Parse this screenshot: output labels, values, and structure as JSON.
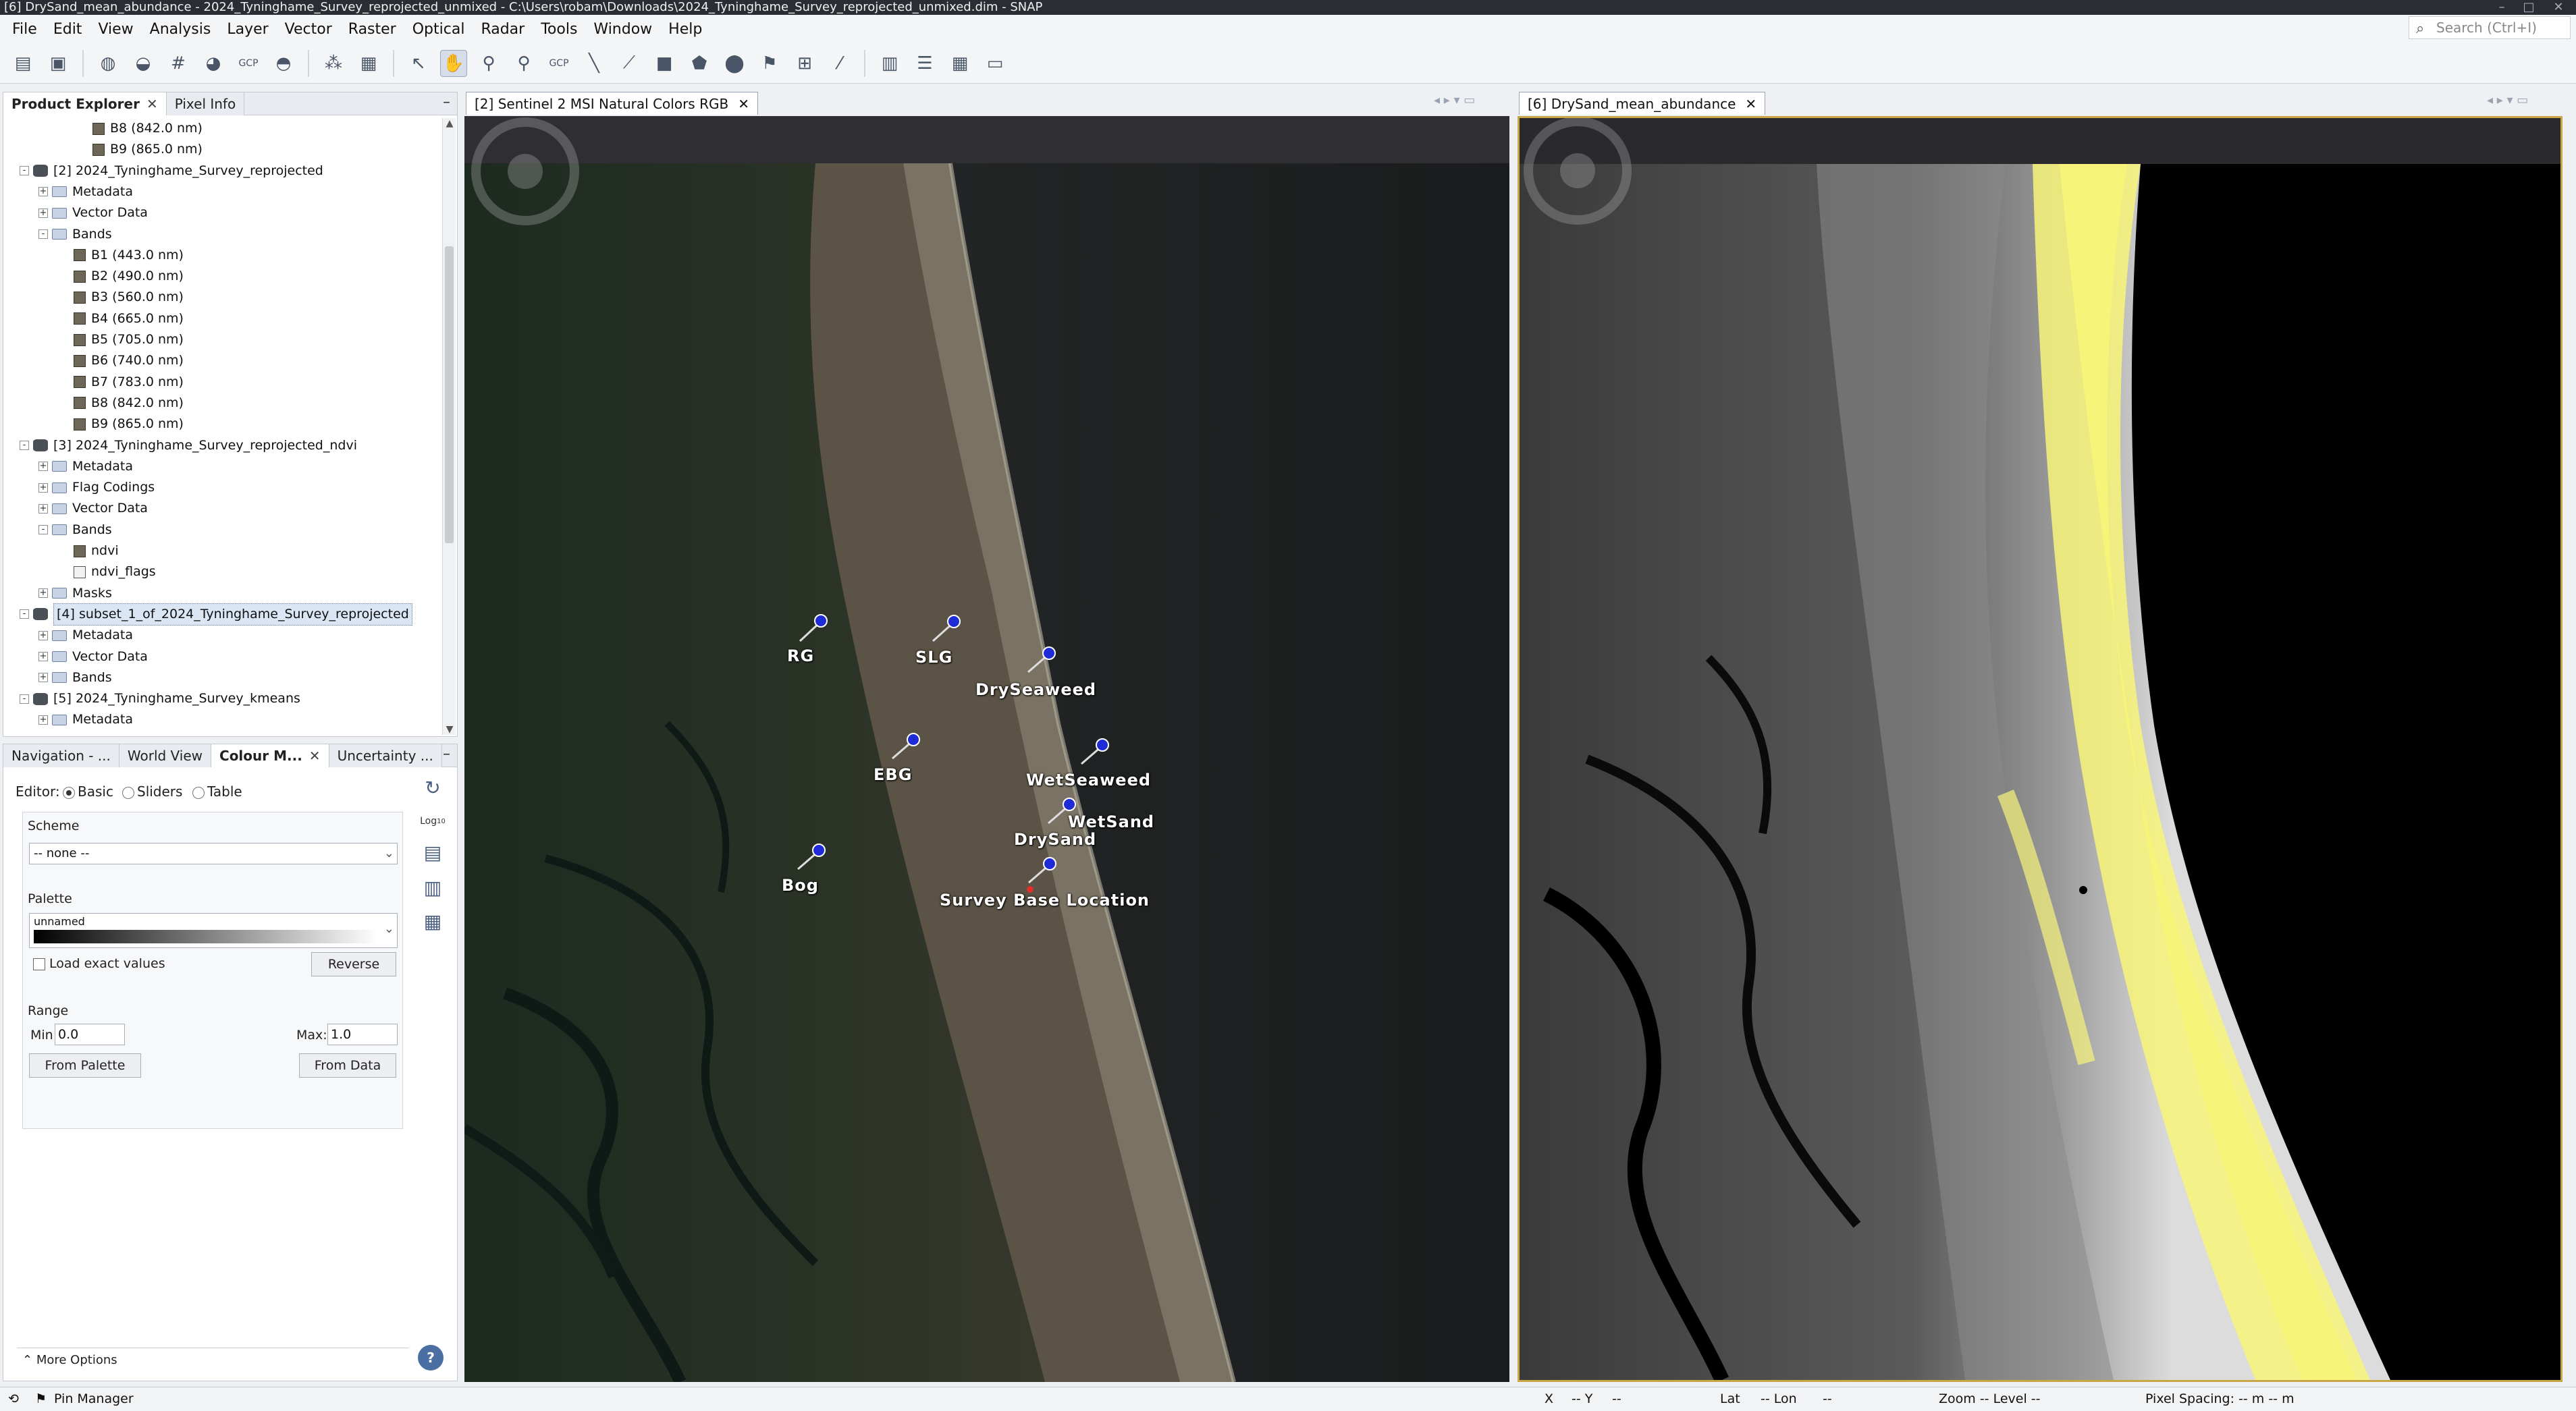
{
  "window": {
    "title": "[6] DrySand_mean_abundance - 2024_Tyninghame_Survey_reprojected_unmixed - C:\\Users\\robam\\Downloads\\2024_Tyninghame_Survey_reprojected_unmixed.dim - SNAP"
  },
  "menu": [
    "File",
    "Edit",
    "View",
    "Analysis",
    "Layer",
    "Vector",
    "Raster",
    "Optical",
    "Radar",
    "Tools",
    "Window",
    "Help"
  ],
  "search": {
    "placeholder": "Search (Ctrl+I)"
  },
  "toolbar_icons": [
    "open-product-icon",
    "save-product-icon",
    "band-maths-icon",
    "filter-icon",
    "graticule-icon",
    "pin-manager-icon",
    "gcp-manager-icon",
    "mask-icon",
    "spectrum-icon",
    "statistics-icon",
    "select-tool-icon",
    "pan-tool-icon",
    "zoom-tool-icon",
    "zoom-all-icon",
    "gcp-tool-icon",
    "line-tool-icon",
    "polyline-tool-icon",
    "rectangle-tool-icon",
    "polygon-tool-icon",
    "ellipse-tool-icon",
    "pin-tool-icon",
    "range-finder-icon",
    "magic-wand-icon",
    "tile-evenly-icon",
    "tile-horizontal-icon",
    "tile-vertical-icon",
    "floating-icon"
  ],
  "product_explorer": {
    "tabs": [
      {
        "label": "Product Explorer",
        "selected": true
      },
      {
        "label": "Pixel Info",
        "selected": false
      }
    ],
    "rows": [
      {
        "label": "B8 (842.0 nm)",
        "type": "band",
        "level": 3
      },
      {
        "label": "B9 (865.0 nm)",
        "type": "band",
        "level": 3
      },
      {
        "label": "[2] 2024_Tyninghame_Survey_reprojected",
        "type": "product",
        "level": 0,
        "expander": "-"
      },
      {
        "label": "Metadata",
        "type": "folder",
        "level": 1,
        "expander": "+"
      },
      {
        "label": "Vector Data",
        "type": "folder",
        "level": 1,
        "expander": "+"
      },
      {
        "label": "Bands",
        "type": "folder",
        "level": 1,
        "expander": "-"
      },
      {
        "label": "B1 (443.0 nm)",
        "type": "band",
        "level": 2
      },
      {
        "label": "B2 (490.0 nm)",
        "type": "band",
        "level": 2
      },
      {
        "label": "B3 (560.0 nm)",
        "type": "band",
        "level": 2
      },
      {
        "label": "B4 (665.0 nm)",
        "type": "band",
        "level": 2
      },
      {
        "label": "B5 (705.0 nm)",
        "type": "band",
        "level": 2
      },
      {
        "label": "B6 (740.0 nm)",
        "type": "band",
        "level": 2
      },
      {
        "label": "B7 (783.0 nm)",
        "type": "band",
        "level": 2
      },
      {
        "label": "B8 (842.0 nm)",
        "type": "band",
        "level": 2
      },
      {
        "label": "B9 (865.0 nm)",
        "type": "band",
        "level": 2
      },
      {
        "label": "[3] 2024_Tyninghame_Survey_reprojected_ndvi",
        "type": "product",
        "level": 0,
        "expander": "-"
      },
      {
        "label": "Metadata",
        "type": "folder",
        "level": 1,
        "expander": "+"
      },
      {
        "label": "Flag Codings",
        "type": "folder",
        "level": 1,
        "expander": "+"
      },
      {
        "label": "Vector Data",
        "type": "folder",
        "level": 1,
        "expander": "+"
      },
      {
        "label": "Bands",
        "type": "folder",
        "level": 1,
        "expander": "-"
      },
      {
        "label": "ndvi",
        "type": "band",
        "level": 2
      },
      {
        "label": "ndvi_flags",
        "type": "flag",
        "level": 2
      },
      {
        "label": "Masks",
        "type": "folder",
        "level": 1,
        "expander": "+"
      },
      {
        "label": "[4] subset_1_of_2024_Tyninghame_Survey_reprojected",
        "type": "product",
        "level": 0,
        "expander": "-",
        "selected": true
      },
      {
        "label": "Metadata",
        "type": "folder",
        "level": 1,
        "expander": "+"
      },
      {
        "label": "Vector Data",
        "type": "folder",
        "level": 1,
        "expander": "+"
      },
      {
        "label": "Bands",
        "type": "folder",
        "level": 1,
        "expander": "+"
      },
      {
        "label": "[5] 2024_Tyninghame_Survey_kmeans",
        "type": "product",
        "level": 0,
        "expander": "-"
      },
      {
        "label": "Metadata",
        "type": "folder",
        "level": 1,
        "expander": "+"
      }
    ]
  },
  "lower_panel": {
    "tabs": [
      {
        "label": "Navigation - ...",
        "selected": false
      },
      {
        "label": "World View",
        "selected": false
      },
      {
        "label": "Colour M...",
        "selected": true
      },
      {
        "label": "Uncertainty ...",
        "selected": false
      }
    ],
    "editor_label": "Editor:",
    "editor_options": [
      {
        "label": "Basic",
        "selected": true
      },
      {
        "label": "Sliders",
        "selected": false
      },
      {
        "label": "Table",
        "selected": false
      }
    ],
    "scheme_label": "Scheme",
    "scheme_value": "-- none --",
    "palette_label": "Palette",
    "palette_value": "unnamed",
    "load_exact_label": "Load exact values",
    "reverse_label": "Reverse",
    "range_label": "Range",
    "min_label": "Min:",
    "min_value": "0.0",
    "max_label": "Max:",
    "max_value": "1.0",
    "from_palette_label": "From Palette",
    "from_data_label": "From Data",
    "log_label": "Log",
    "log_sub": "10",
    "more_options_label": "More Options"
  },
  "left_view": {
    "tab_label": "[2] Sentinel 2 MSI Natural Colors RGB",
    "pins": [
      "RG",
      "SLG",
      "DrySeaweed",
      "EBG",
      "WetSeaweed",
      "WetSand",
      "DrySand",
      "Bog",
      "Survey Base Location"
    ]
  },
  "right_view": {
    "tab_label": "[6] DrySand_mean_abundance",
    "highlight_color": "#f8f47a"
  },
  "status": {
    "pin_manager": "Pin Manager",
    "x": "X",
    "x_val": "-- Y",
    "y_val": "--",
    "lat": "Lat",
    "lat_val": "-- Lon",
    "lon_val": "--",
    "zoom": "Zoom -- Level --",
    "spacing": "Pixel Spacing: -- m -- m"
  }
}
